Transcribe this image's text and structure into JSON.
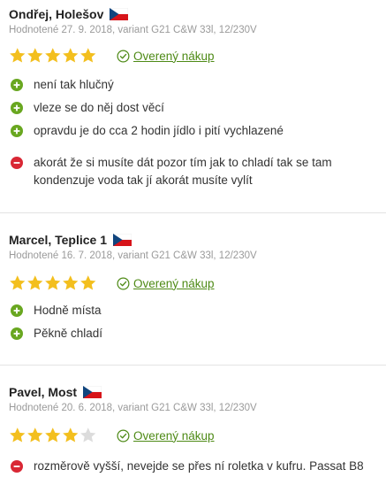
{
  "colors": {
    "star_filled": "#f3bf1e",
    "star_empty": "#dcdcdc",
    "pro": "#69a720",
    "con": "#d92734",
    "verified": "#4e8a16"
  },
  "reviews": [
    {
      "author": "Ondřej, Holešov",
      "meta": "Hodnotené 27. 9. 2018, variant G21 C&W 33l, 12/230V",
      "rating": 5,
      "verified_label": "Overený nákup",
      "pros": [
        "není tak hlučný",
        "vleze se do něj dost věcí",
        "opravdu je do cca 2 hodin jídlo i pití vychlazené"
      ],
      "cons": [
        "akorát že si musíte dát pozor tím jak to chladí tak se tam kondenzuje voda tak jí akorát musíte vylít"
      ]
    },
    {
      "author": "Marcel, Teplice 1",
      "meta": "Hodnotené 16. 7. 2018, variant G21 C&W 33l, 12/230V",
      "rating": 5,
      "verified_label": "Overený nákup",
      "pros": [
        "Hodně místa",
        "Pěkně chladí"
      ],
      "cons": []
    },
    {
      "author": "Pavel, Most",
      "meta": "Hodnotené 20. 6. 2018, variant G21 C&W 33l, 12/230V",
      "rating": 4,
      "verified_label": "Overený nákup",
      "pros": [],
      "cons": [
        "rozměrově vyšší, nevejde se přes ní roletka v kufru. Passat B8"
      ]
    }
  ]
}
